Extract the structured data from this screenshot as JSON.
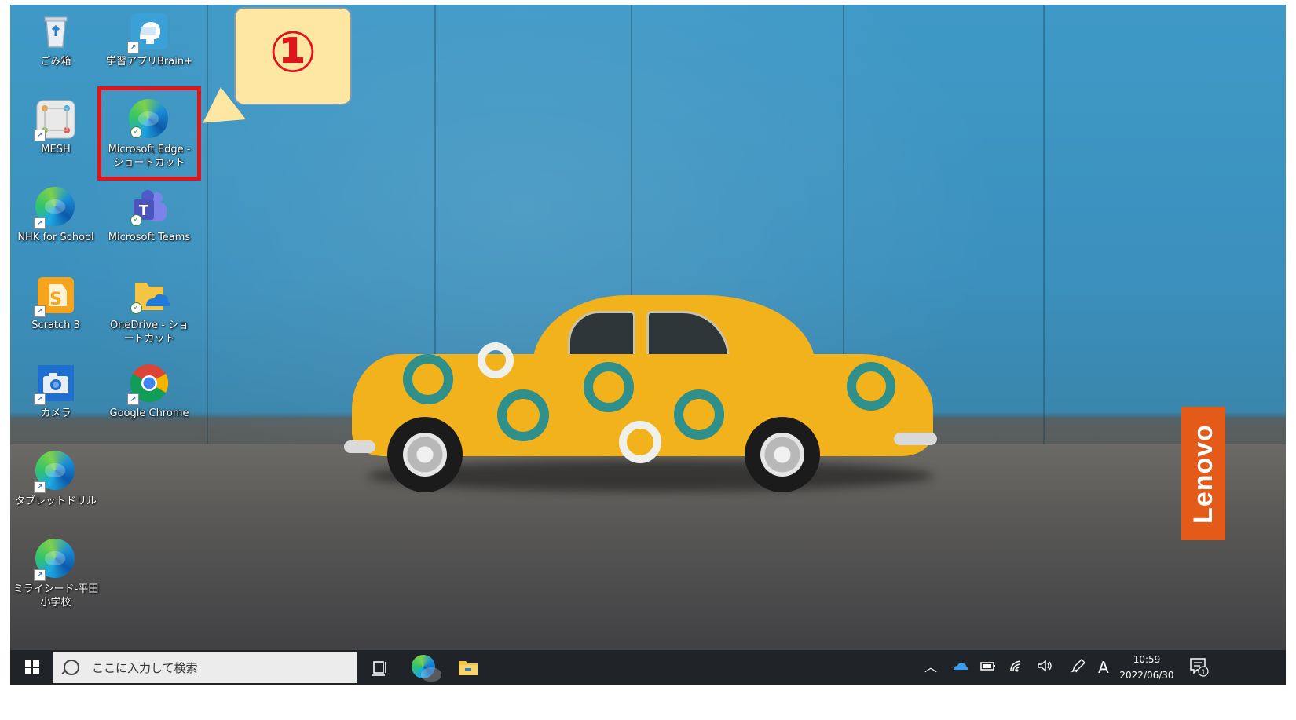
{
  "desktop": {
    "icons": [
      {
        "label": "ごみ箱"
      },
      {
        "label": "学習アプリBrain+"
      },
      {
        "label": "MESH"
      },
      {
        "label": "Microsoft Edge - ショートカット"
      },
      {
        "label": "NHK for School"
      },
      {
        "label": "Microsoft Teams"
      },
      {
        "label": "Scratch 3"
      },
      {
        "label": "OneDrive - ショートカット"
      },
      {
        "label": "カメラ"
      },
      {
        "label": "Google Chrome"
      },
      {
        "label": "タブレットドリル"
      },
      {
        "label": "ミライシード-平田小学校"
      }
    ]
  },
  "callout": {
    "number": "①"
  },
  "wallpaper": {
    "brand": "Lenovo"
  },
  "taskbar": {
    "search_placeholder": "ここに入力して検索",
    "ime_indicator": "A",
    "time": "10:59",
    "date": "2022/06/30",
    "notification_count": "1"
  },
  "colors": {
    "highlight": "#e0141b",
    "taskbar": "#202327",
    "callout_fill": "#fde7a3"
  }
}
